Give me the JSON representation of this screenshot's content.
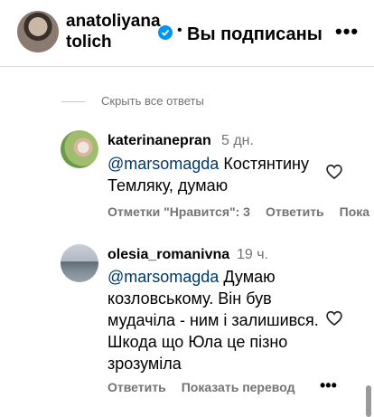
{
  "header": {
    "username": "anatoliyanatolich",
    "username_line1": "anatoliyana",
    "username_line2": "tolich",
    "verified_icon": "verified-badge-icon",
    "separator": "•",
    "subscribed_label": "Вы подписаны",
    "more_label": "•••"
  },
  "replies": {
    "hide_all_label": "Скрыть все ответы"
  },
  "comments": [
    {
      "username": "katerinanepran",
      "time": "5 дн.",
      "mention": "@marsomagda",
      "text": " Костянтину Темляку, думаю",
      "likes_label": "Отметки \"Нравится\": 3",
      "reply_label": "Ответить",
      "extra_label": "Пока"
    },
    {
      "username": "olesia_romanivna",
      "time": "19 ч.",
      "mention": "@marsomagda",
      "text": " Думаю козловському. Він був мудачіла - ним і залишився. Шкода що Юла це пізно зрозуміла",
      "reply_label": "Ответить",
      "translate_label": "Показать перевод",
      "more_label": "•••"
    }
  ],
  "colors": {
    "mention": "#00376b",
    "secondary_text": "#737373",
    "verified": "#0095f6"
  }
}
